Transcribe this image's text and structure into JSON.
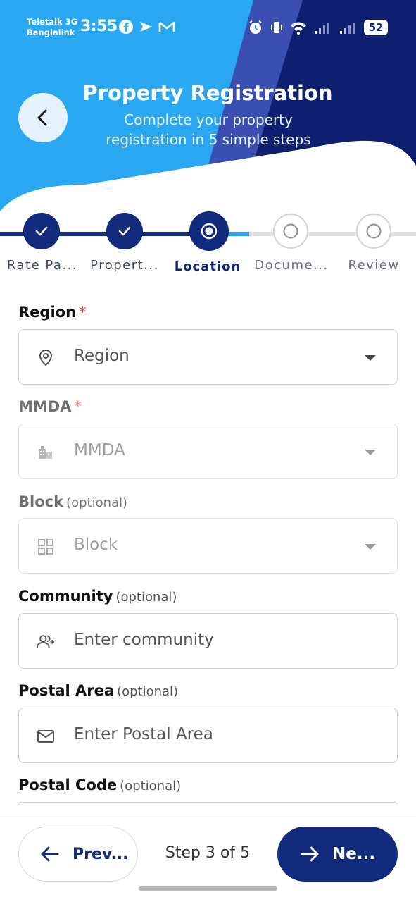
{
  "status_bar": {
    "carrier_1": "Teletalk 3G",
    "carrier_2": "Banglalink",
    "time": "3:55",
    "battery": "52"
  },
  "header": {
    "title": "Property Registration",
    "subtitle_line1": "Complete your property",
    "subtitle_line2": "registration in 5 simple steps"
  },
  "stepper": {
    "steps": [
      {
        "label": "Rate Pa...",
        "state": "done"
      },
      {
        "label": "Propert...",
        "state": "done"
      },
      {
        "label": "Location",
        "state": "active"
      },
      {
        "label": "Docume...",
        "state": "todo"
      },
      {
        "label": "Review",
        "state": "todo"
      }
    ]
  },
  "form": {
    "region": {
      "label": "Region",
      "required": "*",
      "placeholder": "Region"
    },
    "mmda": {
      "label": "MMDA",
      "required": "*",
      "placeholder": "MMDA"
    },
    "block": {
      "label": "Block",
      "optional": "(optional)",
      "placeholder": "Block"
    },
    "community": {
      "label": "Community",
      "optional": "(optional)",
      "placeholder": "Enter community"
    },
    "postal_area": {
      "label": "Postal Area",
      "optional": "(optional)",
      "placeholder": "Enter Postal Area"
    },
    "postal_code": {
      "label": "Postal Code",
      "optional": "(optional)"
    }
  },
  "footer": {
    "prev_label": "Prev...",
    "step_indicator": "Step 3 of 5",
    "next_label": "Ne..."
  },
  "colors": {
    "primary": "#112a7c",
    "header_light": "#29a8f1",
    "header_dark": "#0d1f6e",
    "required": "#e53935"
  }
}
